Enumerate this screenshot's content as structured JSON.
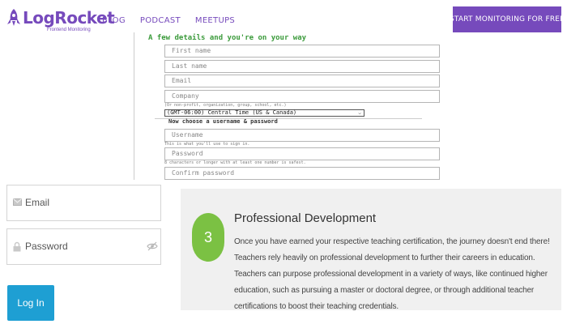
{
  "header": {
    "logo_name": "LogRocket",
    "logo_tagline": "Frontend Monitoring",
    "nav": [
      "BLOG",
      "PODCAST",
      "MEETUPS"
    ],
    "cta_label": "START MONITORING FOR FREE",
    "brand_color": "#764abc"
  },
  "signup_form": {
    "heading": "A few details and you're on your way",
    "first_name_placeholder": "First name",
    "last_name_placeholder": "Last name",
    "email_placeholder": "Email",
    "company_placeholder": "Company",
    "company_hint": "(Or non-profit, organization, group, school, etc.)",
    "timezone_value": "(GMT-06:00) Central Time (US & Canada)",
    "username_section": "Now choose a username & password",
    "username_placeholder": "Username",
    "username_hint": "This is what you'll use to sign in.",
    "password_placeholder": "Password",
    "password_hint": "8 characters or longer with at least one number is safest.",
    "confirm_password_placeholder": "Confirm password",
    "heading_color": "#3a9a3a"
  },
  "login": {
    "email_label": "Email",
    "password_label": "Password",
    "login_button": "Log In",
    "button_color": "#1e9fd3"
  },
  "card": {
    "step_number": "3",
    "title": "Professional Development",
    "body": "Once you have earned your respective teaching certification, the journey doesn't end there! Teachers rely heavily on professional development to further their careers in education. Teachers can purpose professional development in a variety of ways, like continued higher education, such as pursuing a master or doctoral degree, or through additional teacher certifications to boost their teaching credentials.",
    "badge_color": "#7bc143"
  }
}
